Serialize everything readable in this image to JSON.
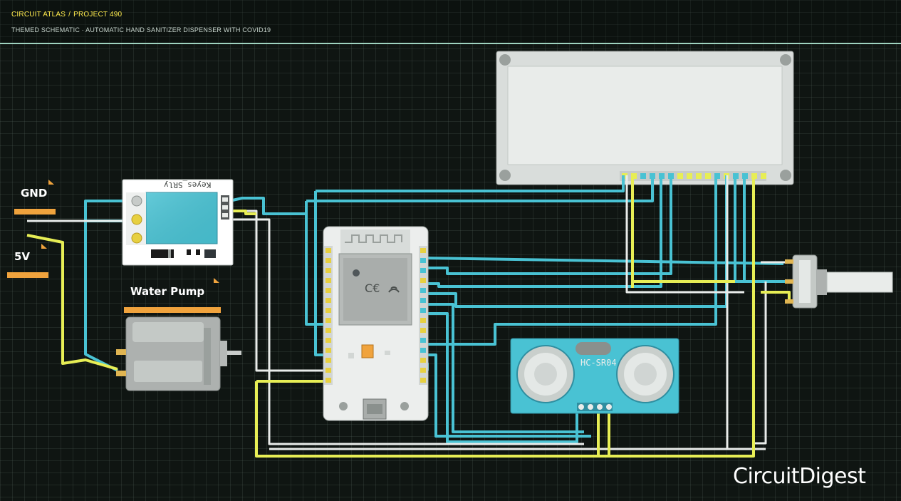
{
  "header": {
    "crumb_site": "CIRCUIT ATLAS",
    "crumb_sep": "/",
    "crumb_project": "PROJECT 490",
    "subtitle": "THEMED SCHEMATIC · AUTOMATIC HAND SANITIZER DISPENSER WITH COVID19"
  },
  "labels": {
    "gnd": "GND",
    "v5": "5V",
    "pump": "Water Pump",
    "relay_brand": "Keyes_SRly",
    "sensor_model": "HC-SR04"
  },
  "brand": {
    "part1": "Circuit",
    "part2": "Digest"
  },
  "colors": {
    "wire_cyan": "#49c2d3",
    "wire_white": "#e9ecea",
    "wire_yellow": "#e7ee55",
    "rail_orange": "#f0a33d",
    "header_accent": "#ffeb4d",
    "header_rule": "#9fd3c0"
  },
  "icons": [
    "wifi-logo-icon",
    "ce-mark-icon"
  ]
}
